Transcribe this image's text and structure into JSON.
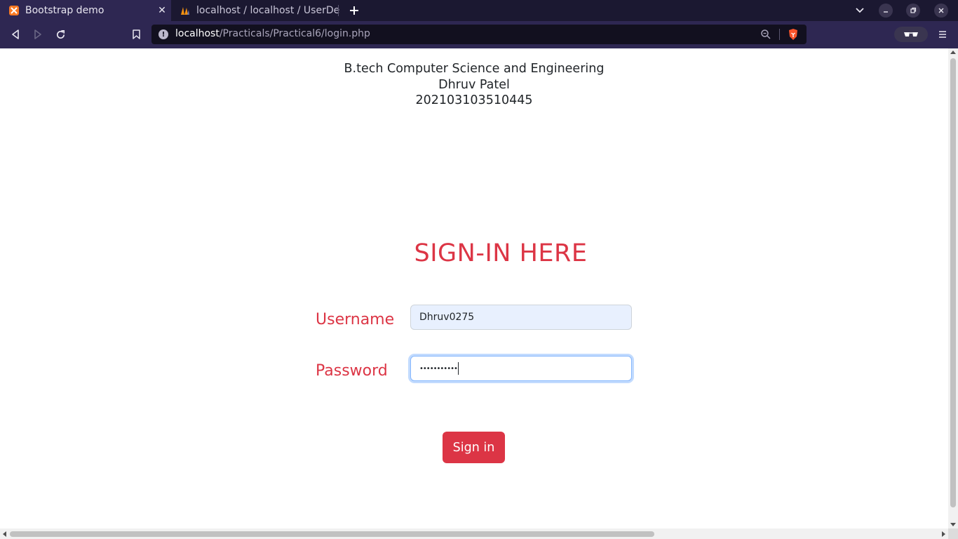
{
  "browser": {
    "tabs": [
      {
        "title": "Bootstrap demo",
        "active": true,
        "icon": "xampp-icon"
      },
      {
        "title": "localhost / localhost / UserDe",
        "active": false,
        "icon": "phpmyadmin-icon"
      }
    ],
    "url": {
      "host": "localhost",
      "path": "/Practicals/Practical6/login.php"
    }
  },
  "page": {
    "header_lines": [
      "B.tech Computer Science and Engineering",
      "Dhruv Patel",
      "202103103510445"
    ],
    "title": "SIGN-IN HERE",
    "form": {
      "username_label": "Username",
      "username_value": "Dhruv0275",
      "password_label": "Password",
      "password_value": "•••••••••••",
      "submit_label": "Sign in"
    }
  },
  "colors": {
    "accent": "#dc3545",
    "chrome_dark": "#1b1831",
    "chrome_toolbar": "#2e2752",
    "autofill_bg": "#e8f0fe"
  }
}
